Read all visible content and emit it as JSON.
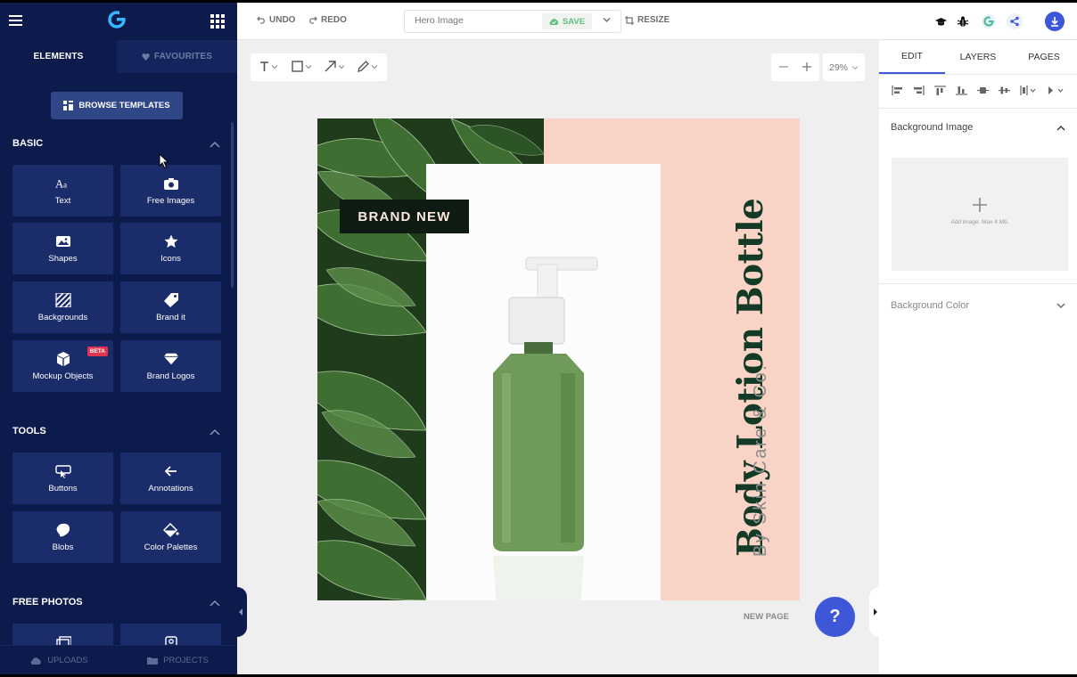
{
  "colors": {
    "sidebar_bg": "#0c1a4c",
    "tile_bg": "#1b2c6a",
    "accent_blue": "#3d57d8",
    "save_green": "#5fc07c",
    "design_pink": "#f9d4c6",
    "design_title_green": "#123a26",
    "beta_red": "#e2344d"
  },
  "sidebar": {
    "tabs": {
      "elements": "ELEMENTS",
      "favourites": "FAVOURITES"
    },
    "browse_templates": "BROWSE TEMPLATES",
    "sections": {
      "basic": "BASIC",
      "tools": "TOOLS",
      "free_photos": "FREE PHOTOS"
    },
    "basic_items": [
      {
        "label": "Text",
        "icon": "text-icon"
      },
      {
        "label": "Free Images",
        "icon": "camera-icon"
      },
      {
        "label": "Shapes",
        "icon": "image-icon"
      },
      {
        "label": "Icons",
        "icon": "star-icon"
      },
      {
        "label": "Backgrounds",
        "icon": "stripes-icon"
      },
      {
        "label": "Brand it",
        "icon": "tag-icon"
      },
      {
        "label": "Mockup Objects",
        "icon": "cube-icon",
        "badge": "BETA"
      },
      {
        "label": "Brand Logos",
        "icon": "diamond-icon"
      }
    ],
    "tools_items": [
      {
        "label": "Buttons",
        "icon": "button-cursor-icon"
      },
      {
        "label": "Annotations",
        "icon": "arrow-left-icon"
      },
      {
        "label": "Blobs",
        "icon": "blob-icon"
      },
      {
        "label": "Color Palettes",
        "icon": "paint-bucket-icon"
      }
    ],
    "bottom": {
      "uploads": "UPLOADS",
      "projects": "PROJECTS"
    }
  },
  "topbar": {
    "undo": "UNDO",
    "redo": "REDO",
    "title_placeholder": "Hero Image",
    "save": "SAVE",
    "resize": "RESIZE"
  },
  "canvas": {
    "zoom": "29%",
    "new_page": "NEW PAGE",
    "help": "?"
  },
  "design": {
    "badge": "BRAND NEW",
    "title": "Body Lotion Bottle",
    "subtitle": "By Skin Care & Co."
  },
  "right_panel": {
    "tabs": {
      "edit": "EDIT",
      "layers": "LAYERS",
      "pages": "PAGES"
    },
    "background_image": "Background Image",
    "drop_hint": "Add image. Max 4 Mb.",
    "background_color": "Background Color"
  }
}
